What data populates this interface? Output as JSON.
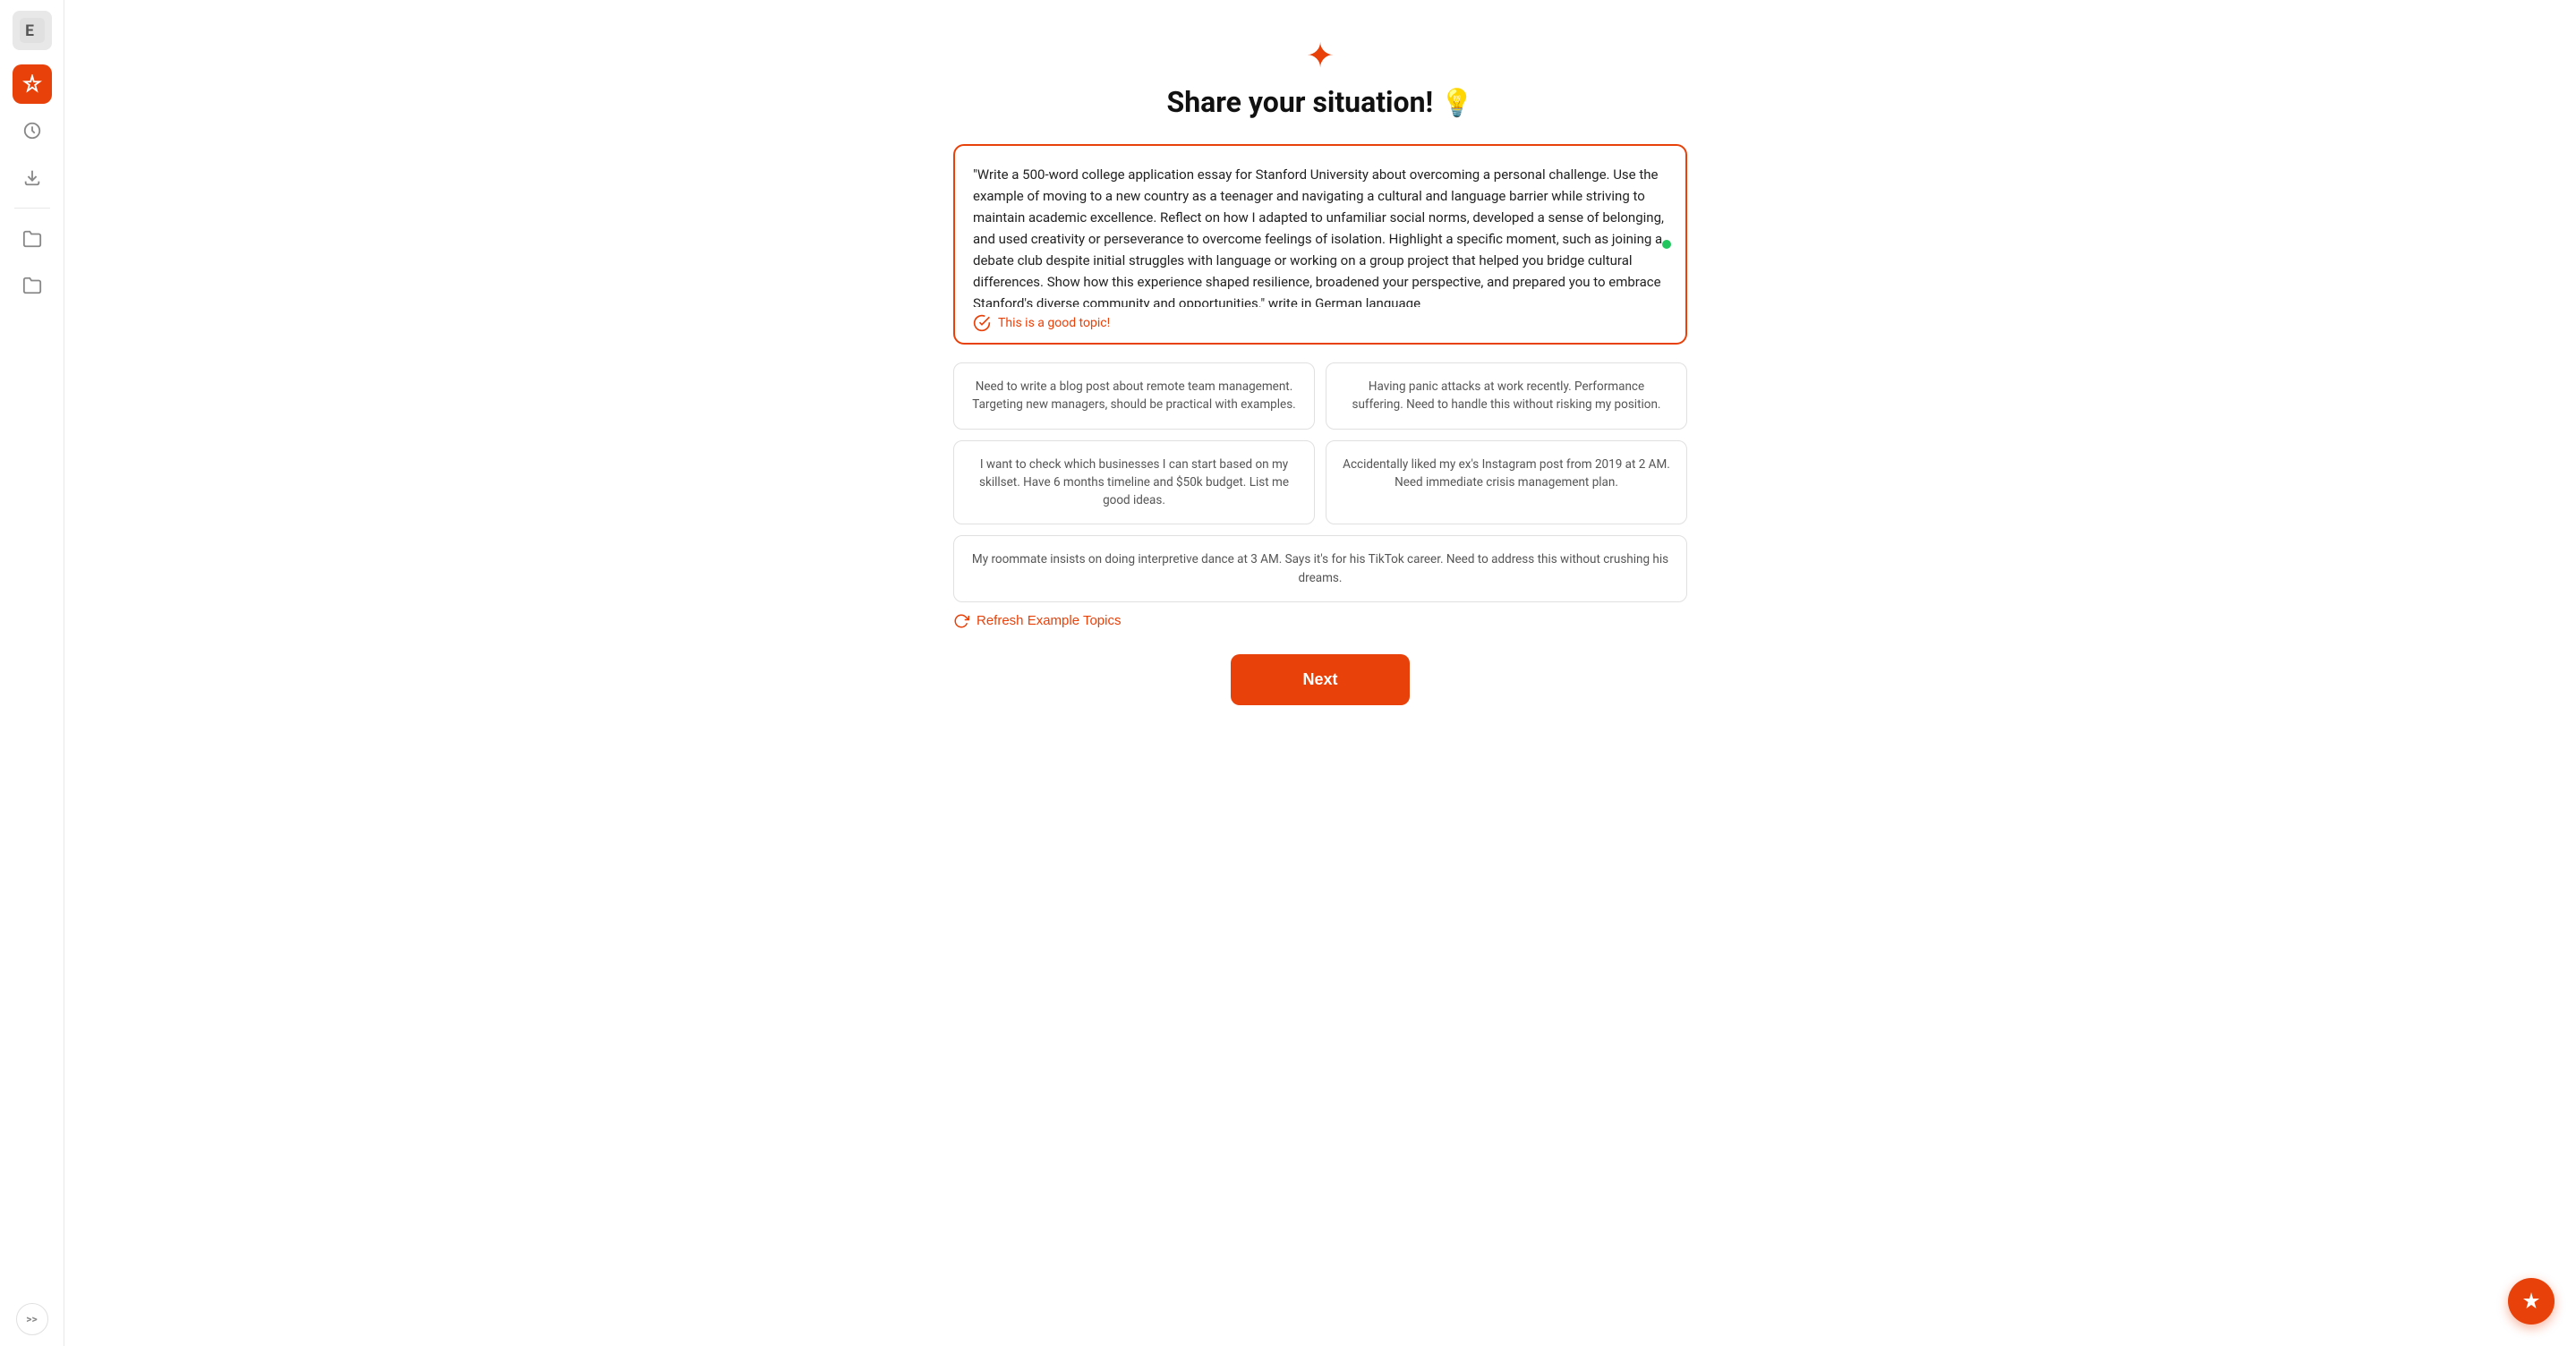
{
  "sidebar": {
    "logo_alt": "E logo",
    "items": [
      {
        "name": "ai-button",
        "label": "AI",
        "active": true
      },
      {
        "name": "history-button",
        "label": "History",
        "active": false
      },
      {
        "name": "export-button",
        "label": "Export",
        "active": false
      },
      {
        "name": "folder1-button",
        "label": "Folder 1",
        "active": false
      },
      {
        "name": "folder2-button",
        "label": "Folder 2",
        "active": false
      }
    ],
    "expand_label": ">>"
  },
  "page": {
    "spark_icon": "✦",
    "title": "Share your situation!",
    "title_emoji": "💡",
    "textarea_value": "\"Write a 500-word college application essay for Stanford University about overcoming a personal challenge. Use the example of moving to a new country as a teenager and navigating a cultural and language barrier while striving to maintain academic excellence. Reflect on how I adapted to unfamiliar social norms, developed a sense of belonging, and used creativity or perseverance to overcome feelings of isolation. Highlight a specific moment, such as joining a debate club despite initial struggles with language or working on a group project that helped you bridge cultural differences. Show how this experience shaped resilience, broadened your perspective, and prepared you to embrace Stanford's diverse community and opportunities.\" write in German language",
    "good_topic_label": "This is a good topic!",
    "example_cards": [
      {
        "id": "card1",
        "text": "Need to write a blog post about remote team management. Targeting new managers, should be practical with examples.",
        "full_width": false
      },
      {
        "id": "card2",
        "text": "Having panic attacks at work recently. Performance suffering. Need to handle this without risking my position.",
        "full_width": false
      },
      {
        "id": "card3",
        "text": "I want to check which businesses I can start based on my skillset. Have 6 months timeline and $50k budget. List me good ideas.",
        "full_width": false
      },
      {
        "id": "card4",
        "text": "Accidentally liked my ex's Instagram post from 2019 at 2 AM. Need immediate crisis management plan.",
        "full_width": false
      },
      {
        "id": "card5",
        "text": "My roommate insists on doing interpretive dance at 3 AM. Says it's for his TikTok career. Need to address this without crushing his dreams.",
        "full_width": true
      }
    ],
    "refresh_label": "Refresh Example Topics",
    "next_label": "Next"
  },
  "colors": {
    "accent": "#e8410a",
    "green": "#22c55e"
  }
}
